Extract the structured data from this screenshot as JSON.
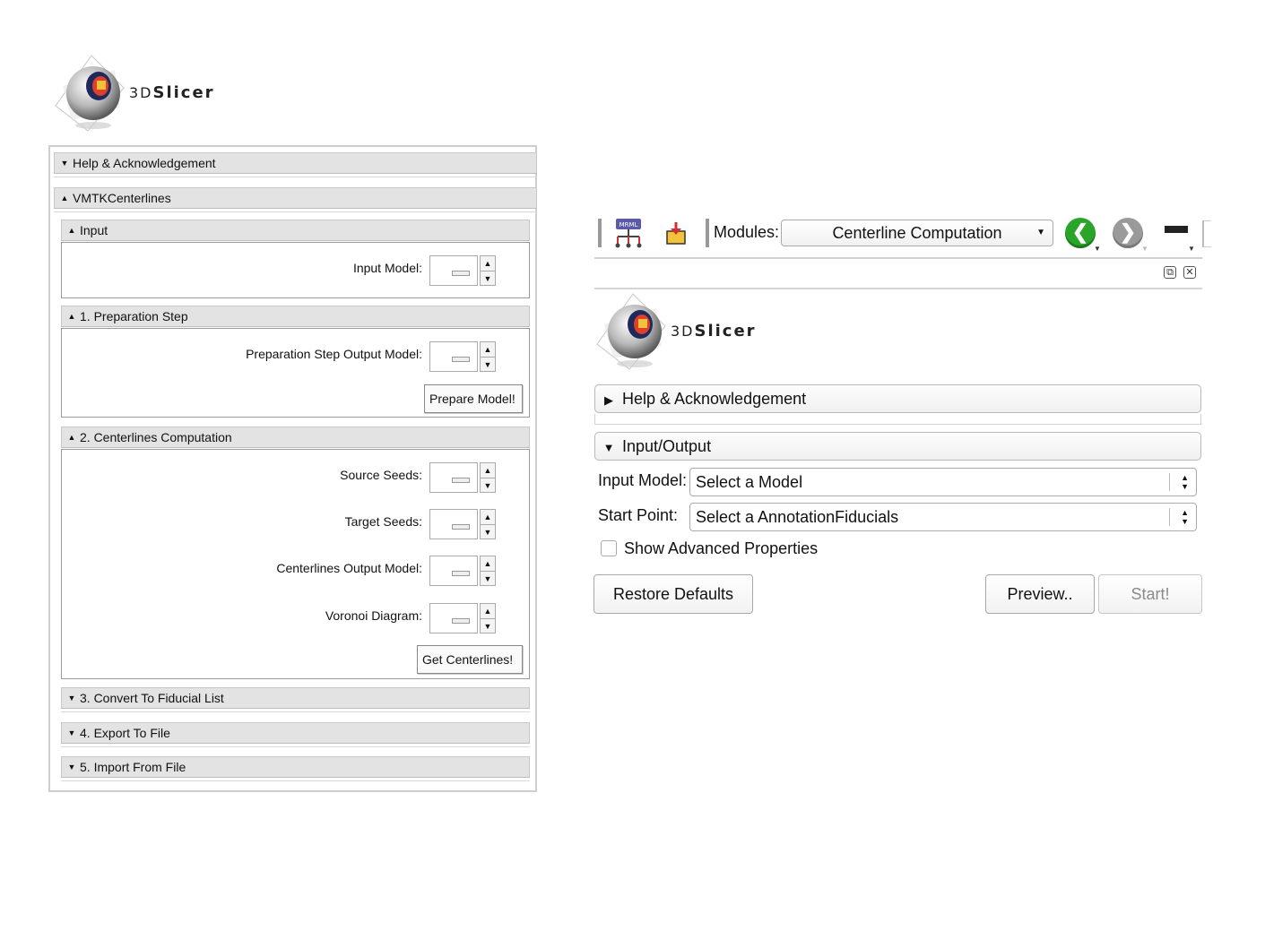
{
  "logo": {
    "text_3d": "3D",
    "text_slicer": "Slicer"
  },
  "left_panel": {
    "help_header": "Help & Acknowledgement",
    "module_header": "VMTKCenterlines",
    "input_section": {
      "title": "Input",
      "input_model_label": "Input Model:"
    },
    "prep_section": {
      "title": "1. Preparation Step",
      "output_label": "Preparation Step Output Model:",
      "button": "Prepare Model!"
    },
    "centerlines_section": {
      "title": "2. Centerlines Computation",
      "source_label": "Source Seeds:",
      "target_label": "Target Seeds:",
      "output_label": "Centerlines Output Model:",
      "voronoi_label": "Voronoi Diagram:",
      "button": "Get Centerlines!"
    },
    "convert_section": {
      "title": "3. Convert To Fiducial List"
    },
    "export_section": {
      "title": "4. Export To File"
    },
    "import_section": {
      "title": "5. Import From File"
    }
  },
  "right_panel": {
    "toolbar": {
      "modules_label": "Modules:",
      "module_selected": "Centerline Computation",
      "mrml_icon_text": "MRML"
    },
    "help_header": "Help & Acknowledgement",
    "io_header": "Input/Output",
    "input_model_label": "Input Model:",
    "input_model_value": "Select a Model",
    "start_point_label": "Start Point:",
    "start_point_value": "Select a AnnotationFiducials",
    "advanced_label": "Show Advanced Properties",
    "restore_button": "Restore Defaults",
    "preview_button": "Preview..",
    "start_button": "Start!"
  },
  "colors": {
    "back_arrow": "#2aa52a",
    "forward_arrow": "#9a9a9a",
    "panel_header": "#e3e3e3"
  }
}
